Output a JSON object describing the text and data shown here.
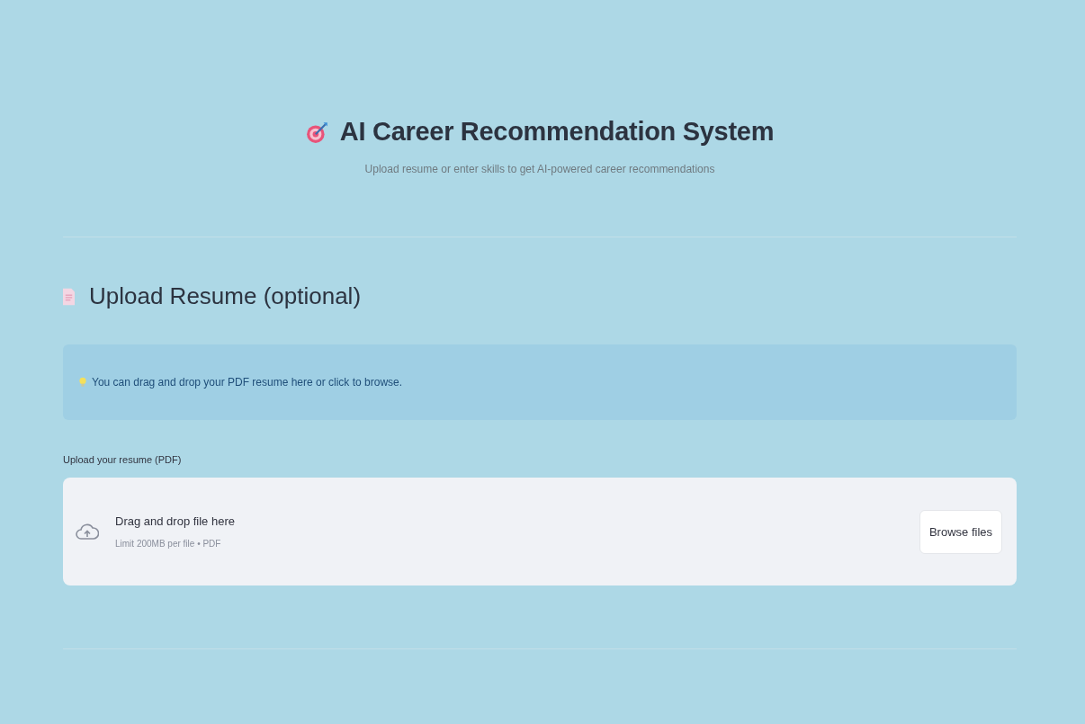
{
  "header": {
    "title": "AI Career Recommendation System",
    "subtitle": "Upload resume or enter skills to get AI-powered career recommendations"
  },
  "section": {
    "heading": "Upload Resume (optional)",
    "info": "You can drag and drop your PDF resume here or click to browse.",
    "uploader": {
      "label": "Upload your resume (PDF)",
      "instruction": "Drag and drop file here",
      "limit": "Limit 200MB per file • PDF",
      "button": "Browse files"
    }
  }
}
